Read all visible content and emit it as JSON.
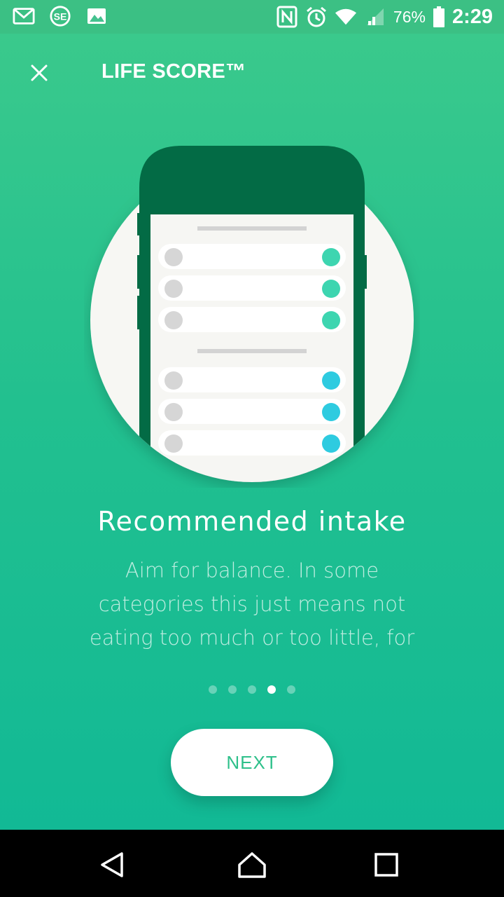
{
  "status_bar": {
    "notification_icons": [
      "gmail-icon",
      "se-app-icon",
      "image-icon"
    ],
    "system_icons": [
      "nfc-icon",
      "alarm-icon",
      "wifi-icon",
      "signal-icon"
    ],
    "battery_percent": "76%",
    "time": "2:29"
  },
  "header": {
    "title": "LIFE SCORE™",
    "close_icon": "close-icon"
  },
  "illustration": {
    "group_1_toggle_color": "#3dd5b0",
    "group_2_toggle_color": "#2ecbe0",
    "phone_color": "#036b45",
    "circle_color": "#f7f7f3"
  },
  "slide": {
    "title": "Recommended intake",
    "body": "Aim for balance. In some categories this just means not eating too much or too little, for",
    "page_count": 5,
    "current_page": 4
  },
  "actions": {
    "next_label": "NEXT"
  },
  "nav_bar": {
    "back_icon": "back-triangle-icon",
    "home_icon": "home-icon",
    "recents_icon": "recents-square-icon"
  },
  "colors": {
    "gradient_top": "#3cca8c",
    "gradient_bottom": "#0fb896",
    "accent_text": "#2ec08a"
  }
}
